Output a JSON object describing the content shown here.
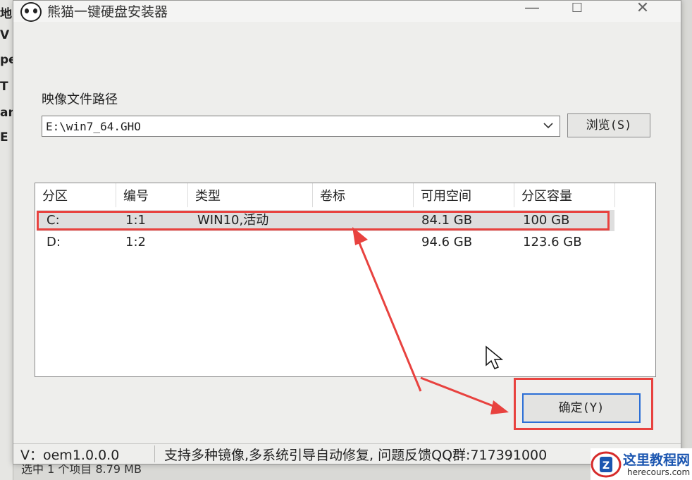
{
  "window": {
    "title": "熊猫一键硬盘安装器",
    "minimize_glyph": "—",
    "maximize_glyph": "☐",
    "close_glyph": "✕"
  },
  "background_window": {
    "edge_chars": [
      "地",
      "V",
      "pe",
      "T",
      "an",
      "E"
    ],
    "status_text": "选中 1 个项目  8.79 MB"
  },
  "image_path": {
    "label": "映像文件路径",
    "value": "E:\\win7_64.GHO",
    "browse_label": "浏览(S)"
  },
  "partition_table": {
    "columns": [
      "分区",
      "编号",
      "类型",
      "卷标",
      "可用空间",
      "分区容量"
    ],
    "rows": [
      {
        "partition": "C:",
        "number": "1:1",
        "type": "WIN10,活动",
        "label": "",
        "free": "84.1 GB",
        "capacity": "100 GB",
        "selected": true
      },
      {
        "partition": "D:",
        "number": "1:2",
        "type": "",
        "label": "",
        "free": "94.6 GB",
        "capacity": "123.6 GB",
        "selected": false
      }
    ]
  },
  "confirm_button": {
    "label": "确定(Y)"
  },
  "status_bar": {
    "version": "V：oem1.0.0.0",
    "message": "支持多种镜像,多系统引导自动修复, 问题反馈QQ群:717391000"
  },
  "watermark": {
    "title": "这里教程网",
    "site": "herecours.com"
  },
  "colors": {
    "annotation": "#e8423f",
    "button_focus": "#2c6fd6",
    "selection": "#dedede"
  },
  "icons": [
    "panda-icon",
    "minimize-icon",
    "maximize-icon",
    "close-icon",
    "chevron-down-icon",
    "mouse-cursor-icon"
  ]
}
